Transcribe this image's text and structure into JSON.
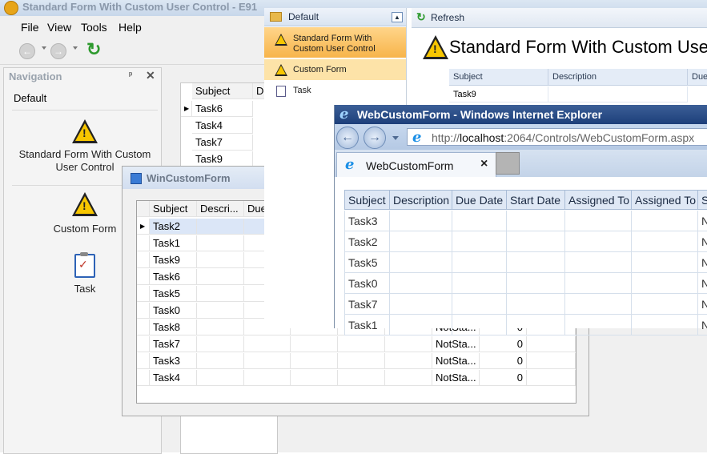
{
  "main_window": {
    "title": "Standard Form With Custom User Control - E91",
    "menu": [
      "File",
      "View",
      "Tools",
      "Help"
    ]
  },
  "navigation": {
    "title": "Navigation",
    "pin": "ᵖ",
    "close": "✕",
    "group": "Default",
    "items": [
      {
        "label": "Standard Form With Custom User Control",
        "icon": "warning-icon"
      },
      {
        "label": "Custom Form",
        "icon": "warning-icon"
      },
      {
        "label": "Task",
        "icon": "task-clipboard-icon"
      }
    ]
  },
  "main_grid": {
    "columns": [
      "Subject",
      "De"
    ],
    "rows": [
      "Task6",
      "Task4",
      "Task7",
      "Task9"
    ]
  },
  "win_custom_form": {
    "title": "WinCustomForm",
    "columns": [
      "Subject",
      "Descri...",
      "Due"
    ],
    "rows": [
      {
        "subject": "Task2",
        "status": "",
        "value": ""
      },
      {
        "subject": "Task1",
        "status": "",
        "value": ""
      },
      {
        "subject": "Task9",
        "status": "",
        "value": ""
      },
      {
        "subject": "Task6",
        "status": "",
        "value": ""
      },
      {
        "subject": "Task5",
        "status": "",
        "value": ""
      },
      {
        "subject": "Task0",
        "status": "",
        "value": ""
      },
      {
        "subject": "Task8",
        "status": "NotSta...",
        "value": "0"
      },
      {
        "subject": "Task7",
        "status": "NotSta...",
        "value": "0"
      },
      {
        "subject": "Task3",
        "status": "NotSta...",
        "value": "0"
      },
      {
        "subject": "Task4",
        "status": "NotSta...",
        "value": "0"
      }
    ]
  },
  "web_admin": {
    "group": "Default",
    "items": [
      {
        "label": "Standard Form With Custom User Control",
        "selected": true
      },
      {
        "label": "Custom Form",
        "selected": false
      },
      {
        "label": "Task",
        "selected": false
      }
    ],
    "refresh_label": "Refresh",
    "view_title": "Standard Form With Custom User",
    "grid_columns": [
      "Subject",
      "Description",
      "Due"
    ],
    "grid_rows": [
      "Task9"
    ]
  },
  "ie": {
    "title": "WebCustomForm - Windows Internet Explorer",
    "url_prefix": "http://",
    "url_host": "localhost",
    "url_rest": ":2064/Controls/WebCustomForm.aspx",
    "tab_label": "WebCustomForm",
    "tab_close": "×",
    "grid_columns": [
      "Subject",
      "Description",
      "Due Date",
      "Start Date",
      "Assigned To",
      "Assigned To",
      "S"
    ],
    "grid_rows": [
      {
        "subject": "Task3",
        "s": "N"
      },
      {
        "subject": "Task2",
        "s": "N"
      },
      {
        "subject": "Task5",
        "s": "N"
      },
      {
        "subject": "Task0",
        "s": "N"
      },
      {
        "subject": "Task7",
        "s": "N"
      },
      {
        "subject": "Task1",
        "s": "N"
      }
    ]
  }
}
